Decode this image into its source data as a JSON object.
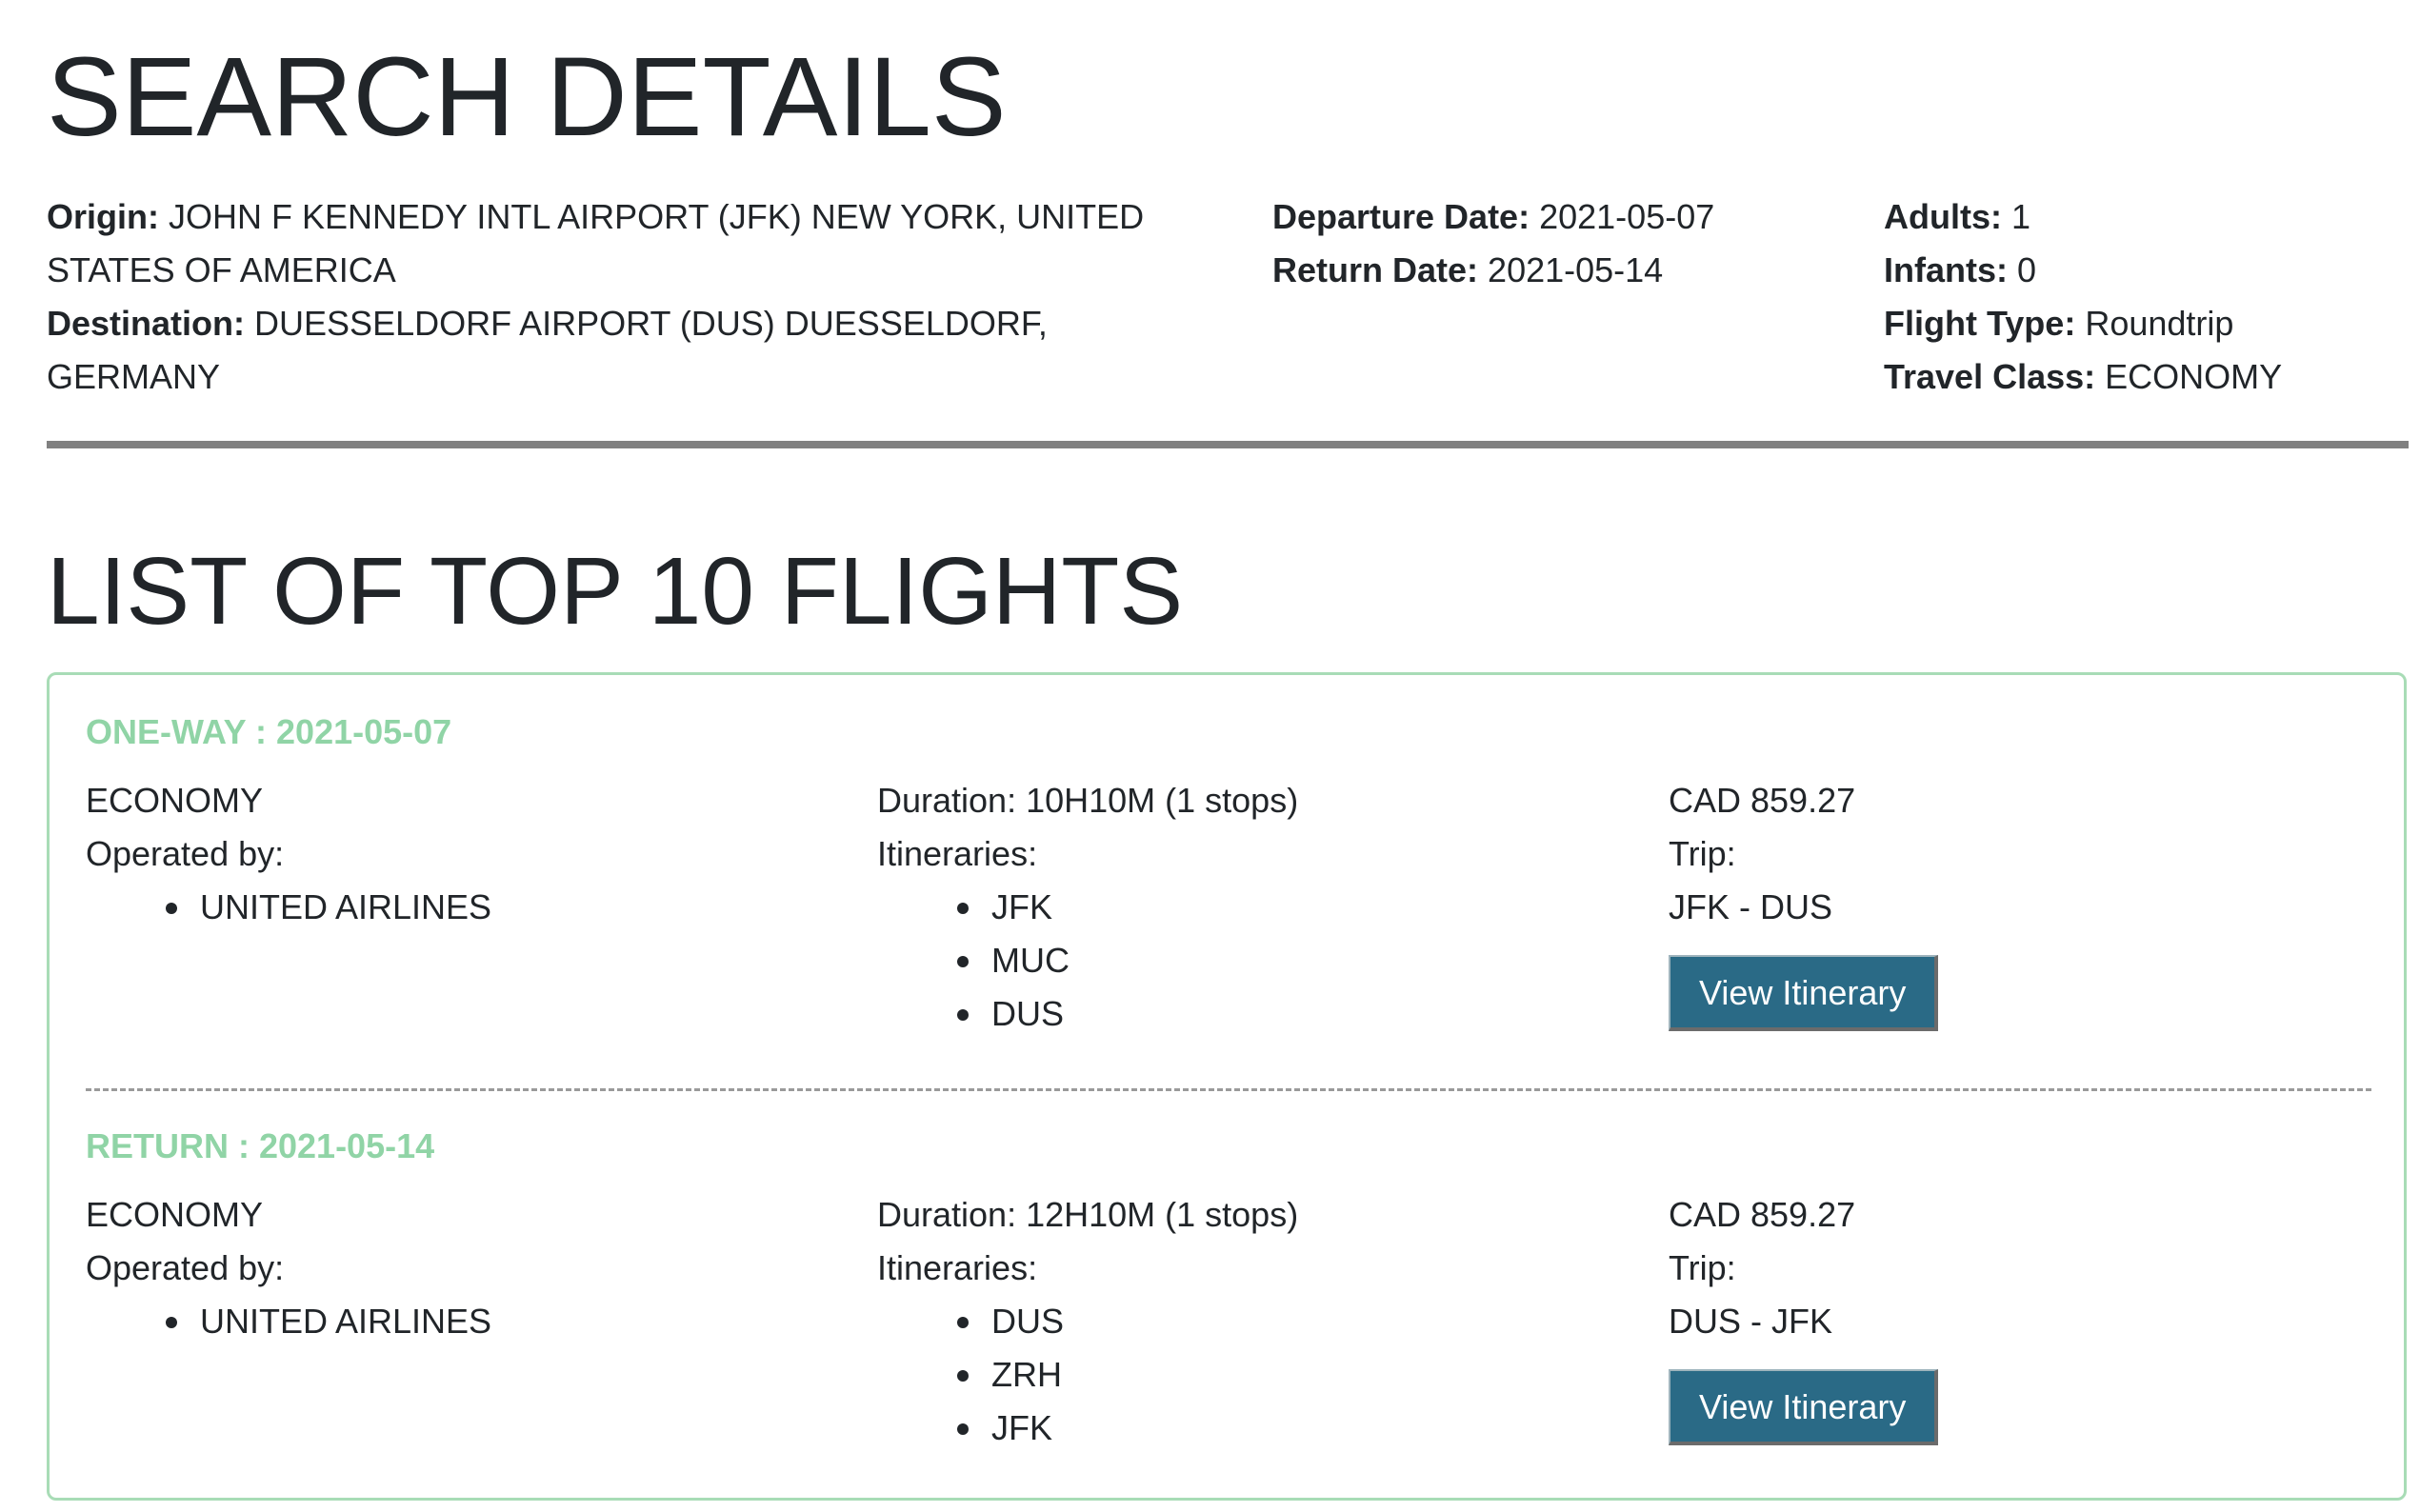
{
  "search": {
    "title": "SEARCH DETAILS",
    "origin_label": "Origin:",
    "origin_value": "JOHN F KENNEDY INTL AIRPORT (JFK) NEW YORK, UNITED STATES OF AMERICA",
    "destination_label": "Destination:",
    "destination_value": "DUESSELDORF AIRPORT (DUS) DUESSELDORF, GERMANY",
    "departure_label": "Departure Date:",
    "departure_value": "2021-05-07",
    "return_label": "Return Date:",
    "return_value": "2021-05-14",
    "adults_label": "Adults:",
    "adults_value": "1",
    "infants_label": "Infants:",
    "infants_value": "0",
    "flight_type_label": "Flight Type:",
    "flight_type_value": "Roundtrip",
    "travel_class_label": "Travel Class:",
    "travel_class_value": "ECONOMY"
  },
  "list": {
    "title": "LIST OF TOP 10 FLIGHTS"
  },
  "flights": [
    {
      "heading": "ONE-WAY : 2021-05-07",
      "cabin": "ECONOMY",
      "operated_label": "Operated by:",
      "carriers": [
        "UNITED AIRLINES"
      ],
      "duration": "Duration: 10H10M (1 stops)",
      "itineraries_label": "Itineraries:",
      "stops": [
        "JFK",
        "MUC",
        "DUS"
      ],
      "price": "CAD 859.27",
      "trip_label": "Trip:",
      "trip": "JFK - DUS",
      "button_label": "View Itinerary"
    },
    {
      "heading": "RETURN : 2021-05-14",
      "cabin": "ECONOMY",
      "operated_label": "Operated by:",
      "carriers": [
        "UNITED AIRLINES"
      ],
      "duration": "Duration: 12H10M (1 stops)",
      "itineraries_label": "Itineraries:",
      "stops": [
        "DUS",
        "ZRH",
        "JFK"
      ],
      "price": "CAD 859.27",
      "trip_label": "Trip:",
      "trip": "DUS - JFK",
      "button_label": "View Itinerary"
    }
  ],
  "colors": {
    "leg_heading": "#90d4a6",
    "card_border": "#a8dcb6",
    "button_bg": "#2a6a86",
    "rule": "#808080"
  }
}
